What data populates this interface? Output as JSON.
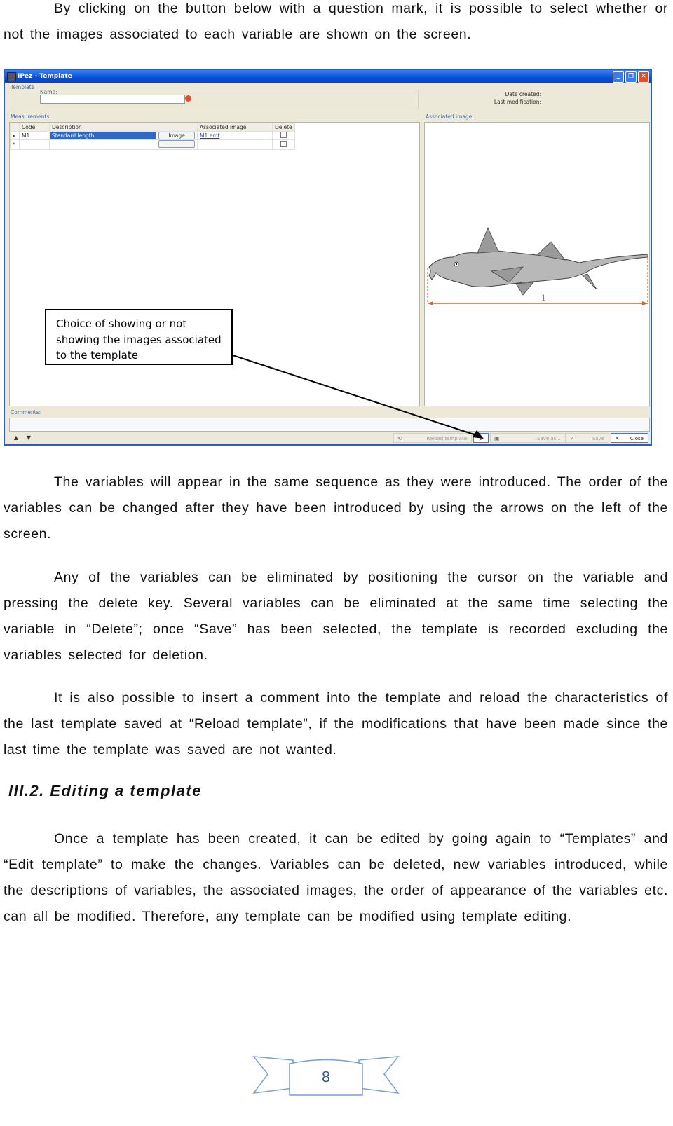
{
  "document": {
    "intro_paragraph": "By clicking on the button below with a question mark, it is possible to select whether or not the images associated to each variable are shown on the screen.",
    "paragraphs_after_figure": [
      "The variables will appear in the same sequence as they were introduced. The order of the variables can be changed after they have been introduced by using the arrows on the left of the screen.",
      "Any of the variables can be eliminated by positioning the cursor on the variable and pressing the delete key. Several variables can be eliminated at the same time selecting the variable in “Delete”; once “Save” has been selected, the template is recorded excluding the variables selected for deletion.",
      "It is also possible to insert a comment into the template and reload the characteristics of the last template saved at “Reload template”, if the modifications that have been made since the last time the template was saved are not wanted."
    ],
    "section_heading": "III.2. Editing a template",
    "section_paragraph": "Once a template has been created, it can be edited by going again to “Templates” and “Edit template” to make the changes. Variables can be deleted, new variables introduced, while the descriptions of variables, the associated images, the order of appearance of the variables etc. can all be modified. Therefore, any template can be modified using template editing.",
    "page_number": "8"
  },
  "window": {
    "title": "IPez - Template",
    "template_group_label": "Template",
    "name_label": "Name:",
    "name_value": "",
    "date_created_label": "Date created:",
    "last_modification_label": "Last modification:",
    "measurements_label": "Measurements:",
    "associated_image_label": "Associated image:",
    "comments_label": "Comments:",
    "comments_value": "",
    "grid": {
      "columns": [
        "Code",
        "Description",
        "",
        "Associated image",
        "Delete"
      ],
      "rows": [
        {
          "code": "M1",
          "description": "Standard length",
          "button": "Image",
          "image": "M1.emf",
          "delete": false
        },
        {
          "code": "",
          "description": "",
          "button": "",
          "image": "",
          "delete": false
        }
      ]
    },
    "image_measure_label": "1",
    "buttons": {
      "reload_template": "Reload template",
      "save_as": "Save as...",
      "save": "Save",
      "close": "Close"
    },
    "title_buttons": {
      "minimize": "_",
      "restore": "❐",
      "close": "✕"
    }
  },
  "callout": {
    "text": "Choice of showing or not showing the images associated to the template"
  },
  "colors": {
    "titlebar": "#0a4fd8",
    "window_bg": "#ece9d8",
    "selection": "#3367c4",
    "measure_line": "#e0602a",
    "page_number": "#3b5a86",
    "ribbon": "#7a9fd0"
  }
}
